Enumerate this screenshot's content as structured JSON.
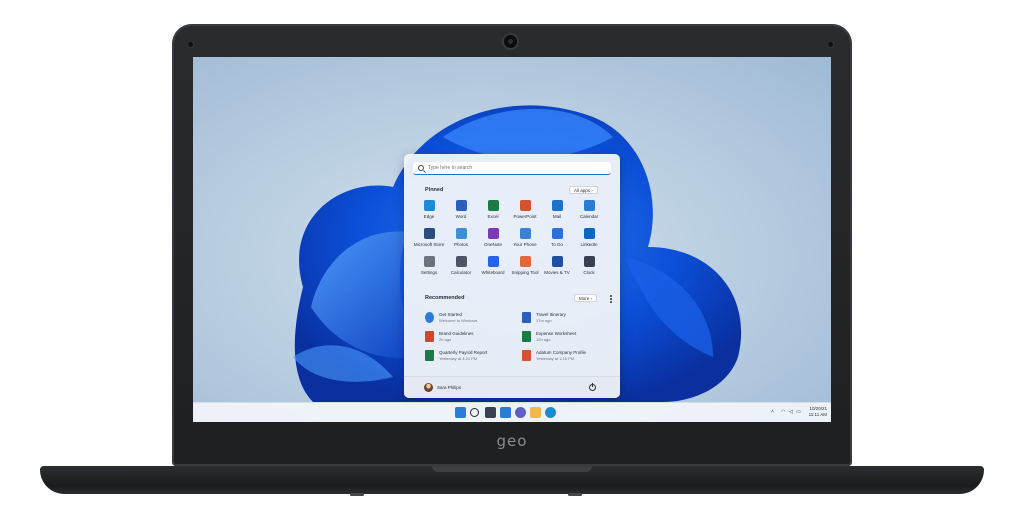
{
  "device": {
    "brand": "geo"
  },
  "start_menu": {
    "search_placeholder": "Type here to search",
    "pinned_title": "Pinned",
    "all_apps_label": "All apps  ›",
    "recommended_title": "Recommended",
    "more_label": "More  ›",
    "pinned": [
      {
        "label": "Edge",
        "icon": "edge-icon",
        "color": "#1b8bd6"
      },
      {
        "label": "Word",
        "icon": "word-icon",
        "color": "#2b5fb8"
      },
      {
        "label": "Excel",
        "icon": "excel-icon",
        "color": "#1d7a45"
      },
      {
        "label": "PowerPoint",
        "icon": "powerpoint-icon",
        "color": "#d35230"
      },
      {
        "label": "Mail",
        "icon": "mail-icon",
        "color": "#1a73c9"
      },
      {
        "label": "Calendar",
        "icon": "calendar-icon",
        "color": "#2a7bd4"
      },
      {
        "label": "Microsoft Store",
        "icon": "store-icon",
        "color": "#2b4c7e"
      },
      {
        "label": "Photos",
        "icon": "photos-icon",
        "color": "#3d8fd6"
      },
      {
        "label": "OneNote",
        "icon": "onenote-icon",
        "color": "#7b3ab8"
      },
      {
        "label": "Your Phone",
        "icon": "phone-icon",
        "color": "#3b82d6"
      },
      {
        "label": "To Do",
        "icon": "todo-icon",
        "color": "#2f6fdc"
      },
      {
        "label": "LinkedIn",
        "icon": "linkedin-icon",
        "color": "#0a66c2"
      },
      {
        "label": "Settings",
        "icon": "settings-icon",
        "color": "#6b7280"
      },
      {
        "label": "Calculator",
        "icon": "calculator-icon",
        "color": "#4b5563"
      },
      {
        "label": "Whiteboard",
        "icon": "whiteboard-icon",
        "color": "#2563eb"
      },
      {
        "label": "Snipping Tool",
        "icon": "snipping-tool-icon",
        "color": "#e0683b"
      },
      {
        "label": "Movies & TV",
        "icon": "movies-tv-icon",
        "color": "#1e4fa3"
      },
      {
        "label": "Clock",
        "icon": "clock-icon",
        "color": "#374151"
      }
    ],
    "recommended": [
      {
        "name": "Get Started",
        "sub": "Welcome to Windows",
        "icon": "get-started-icon",
        "color": "#2b7bd8"
      },
      {
        "name": "Travel Itinerary",
        "sub": "17m ago",
        "icon": "word-doc-icon",
        "color": "#2b5fb8"
      },
      {
        "name": "Brand Guidelines",
        "sub": "2h ago",
        "icon": "pdf-icon",
        "color": "#d0472f"
      },
      {
        "name": "Expense Worksheet",
        "sub": "12h ago",
        "icon": "excel-doc-icon",
        "color": "#1d7a45"
      },
      {
        "name": "Quarterly Payroll Report",
        "sub": "Yesterday at 4:24 PM",
        "icon": "excel-doc-icon",
        "color": "#1d7a45"
      },
      {
        "name": "Adatum Company Profile",
        "sub": "Yesterday at 1:15 PM",
        "icon": "powerpoint-doc-icon",
        "color": "#d35230"
      }
    ],
    "user_name": "Sara Philips"
  },
  "taskbar": {
    "icons": [
      {
        "icon": "windows-start-icon",
        "color": "#2b7bd8"
      },
      {
        "icon": "search-icon",
        "color": "#1f2937"
      },
      {
        "icon": "task-view-icon",
        "color": "#374151"
      },
      {
        "icon": "widgets-icon",
        "color": "#2b7bd8"
      },
      {
        "icon": "chat-icon",
        "color": "#5b5fc7"
      },
      {
        "icon": "file-explorer-icon",
        "color": "#f2b84b"
      },
      {
        "icon": "edge-icon",
        "color": "#1b8bd6"
      }
    ],
    "date": "10/20/21",
    "time": "11:11 AM"
  }
}
